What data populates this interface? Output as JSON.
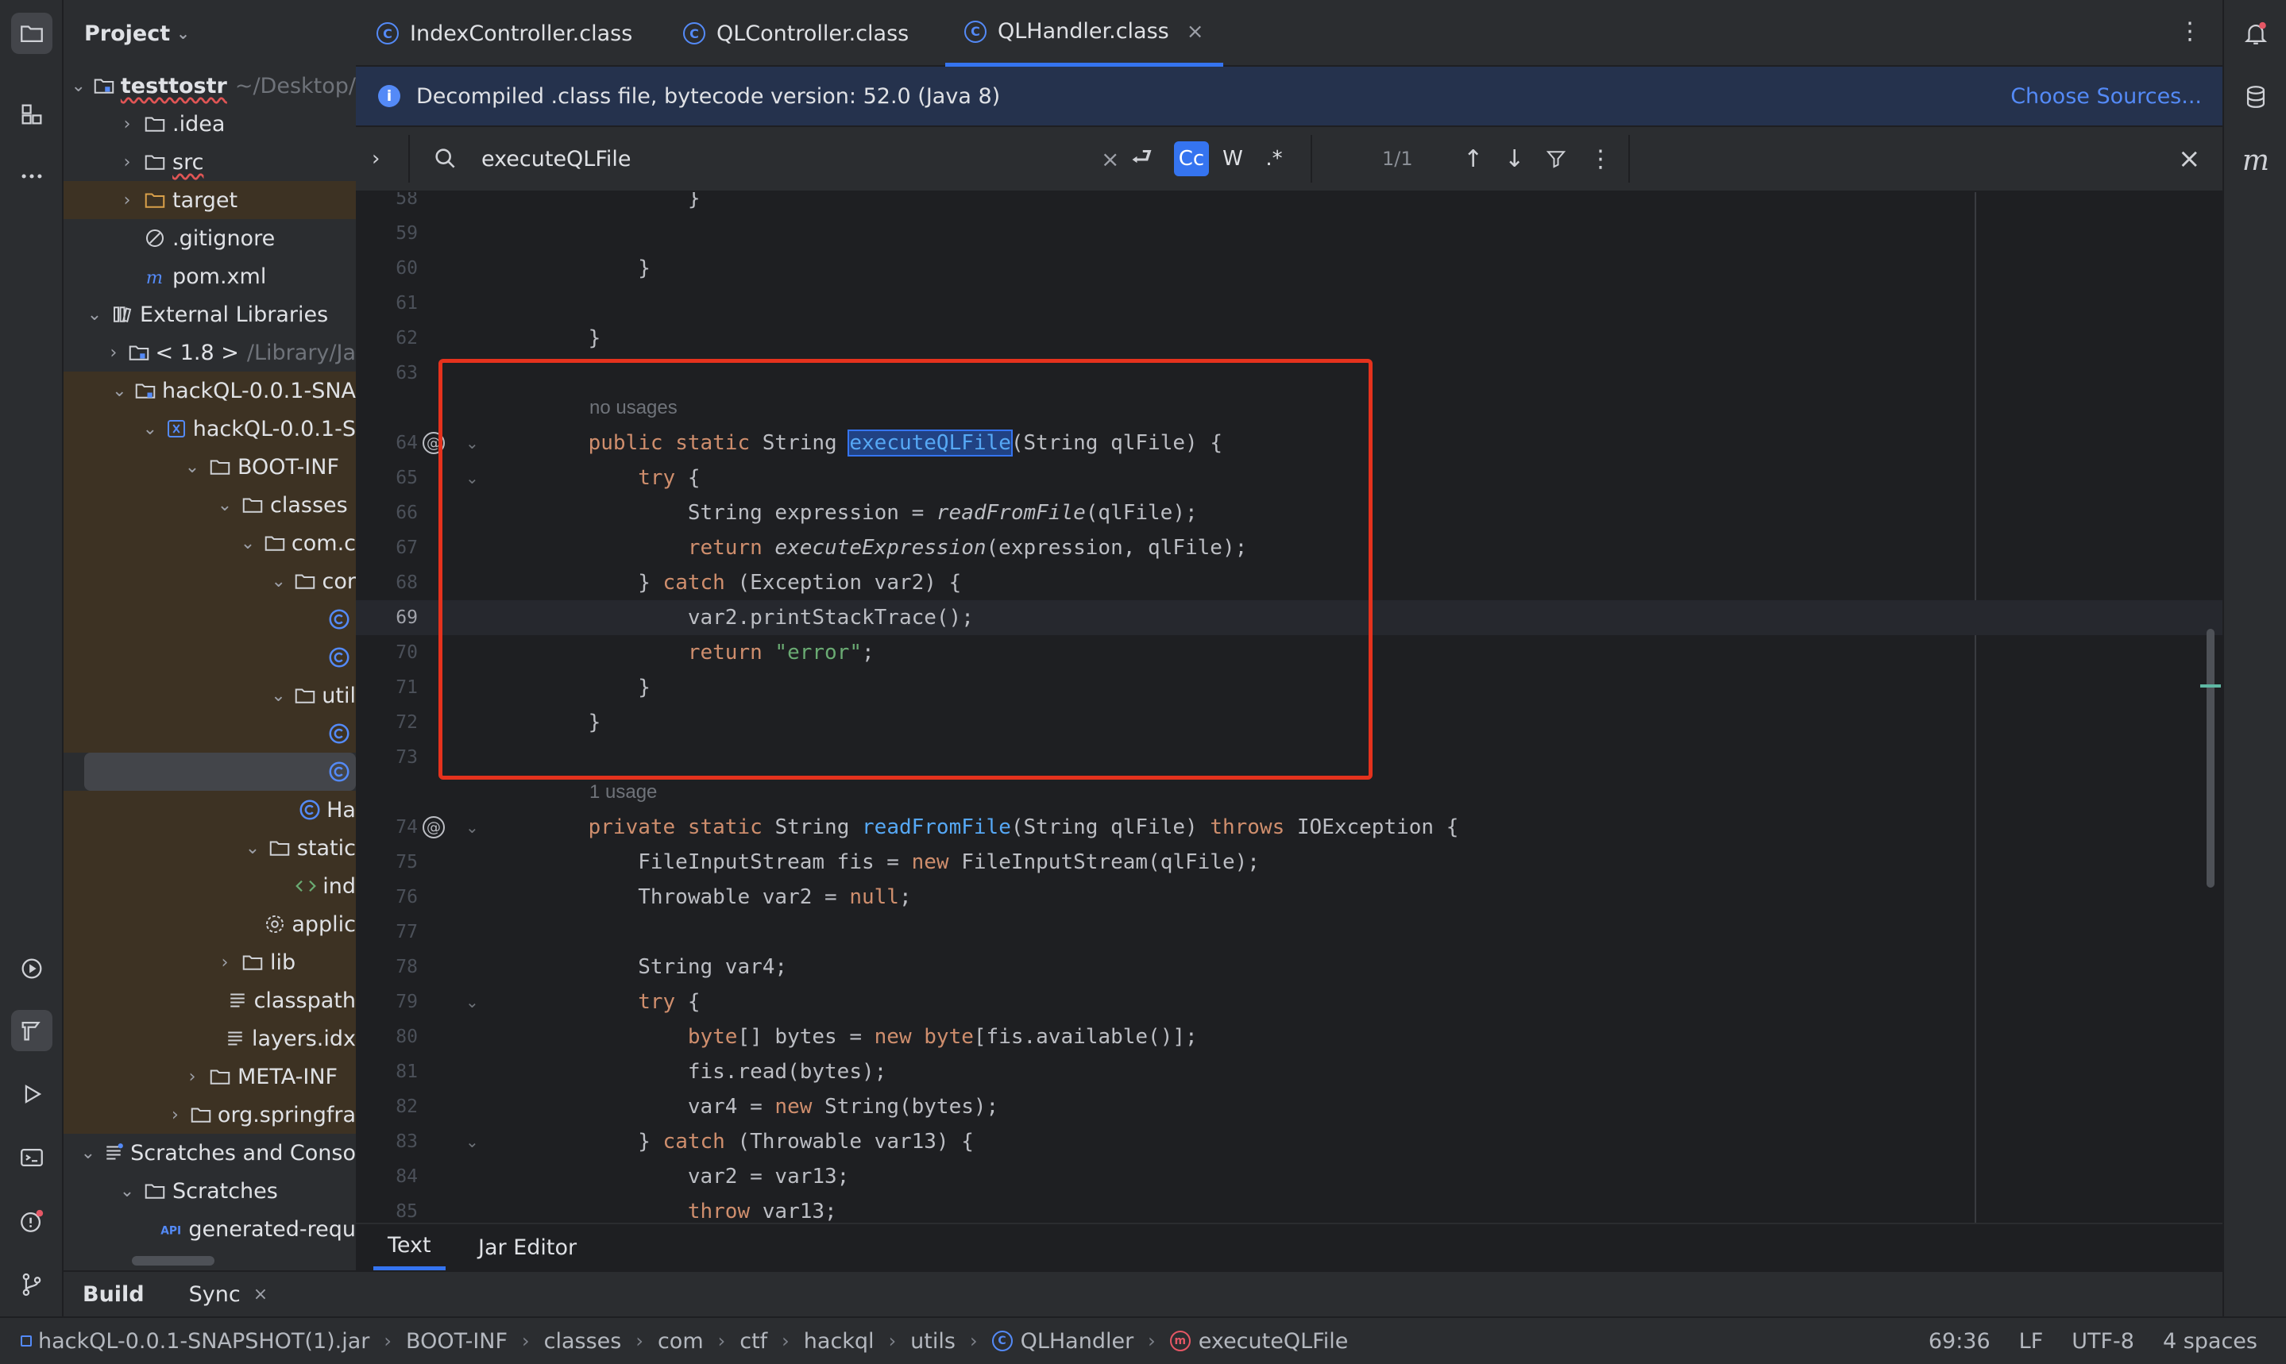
{
  "colors": {
    "accent": "#3574f0",
    "class_icon": "#548af7",
    "keyword": "#cf8e6d",
    "function": "#56a8f5",
    "string": "#6aab73",
    "highlight_box": "#e5321d"
  },
  "project_panel": {
    "title": "Project",
    "tree": [
      {
        "label": "testtostr",
        "hint": "~/Desktop/",
        "icon": "folder-module-icon"
      },
      {
        "label": ".idea",
        "icon": "folder-icon"
      },
      {
        "label": "src",
        "icon": "folder-icon"
      },
      {
        "label": "target",
        "icon": "folder-excluded-icon"
      },
      {
        "label": ".gitignore",
        "icon": "ignore-file-icon"
      },
      {
        "label": "pom.xml",
        "icon": "maven-icon"
      },
      {
        "label": "External Libraries",
        "icon": "library-icon"
      },
      {
        "label": "< 1.8 >",
        "hint": "/Library/Ja",
        "icon": "sdk-folder-icon"
      },
      {
        "label": "hackQL-0.0.1-SNA",
        "icon": "jar-folder-icon"
      },
      {
        "label": "hackQL-0.0.1-S",
        "icon": "archive-icon"
      },
      {
        "label": "BOOT-INF",
        "icon": "folder-icon"
      },
      {
        "label": "classes",
        "icon": "folder-icon"
      },
      {
        "label": "com.c",
        "icon": "folder-icon"
      },
      {
        "label": "cor",
        "icon": "folder-icon"
      },
      {
        "label": "",
        "icon": "class-icon"
      },
      {
        "label": "",
        "icon": "class-icon"
      },
      {
        "label": "util",
        "icon": "folder-icon"
      },
      {
        "label": "",
        "icon": "class-icon"
      },
      {
        "label": "",
        "icon": "class-icon"
      },
      {
        "label": "Ha",
        "icon": "class-icon"
      },
      {
        "label": "static",
        "icon": "folder-icon"
      },
      {
        "label": "ind",
        "icon": "html-icon"
      },
      {
        "label": "applic",
        "icon": "settings-file-icon"
      },
      {
        "label": "lib",
        "icon": "folder-icon"
      },
      {
        "label": "classpath",
        "icon": "text-file-icon"
      },
      {
        "label": "layers.idx",
        "icon": "text-file-icon"
      },
      {
        "label": "META-INF",
        "icon": "folder-icon"
      },
      {
        "label": "org.springfra",
        "icon": "folder-icon"
      },
      {
        "label": "Scratches and Conso",
        "icon": "scratches-icon"
      },
      {
        "label": "Scratches",
        "icon": "folder-icon"
      },
      {
        "label": "generated-requ",
        "icon": "http-request-icon"
      }
    ]
  },
  "editor_tabs": [
    {
      "label": "IndexController.class"
    },
    {
      "label": "QLController.class"
    },
    {
      "label": "QLHandler.class",
      "close": "×"
    }
  ],
  "banner": {
    "message": "Decompiled .class file, bytecode version: 52.0 (Java 8)",
    "link": "Choose Sources..."
  },
  "find_bar": {
    "query": "executeQLFile",
    "clear": "×",
    "match_case": "Cc",
    "words": "W",
    "regex": ".*",
    "count": "1/1"
  },
  "code_lines": [
    {
      "n": "58",
      "segs": [
        {
          "t": "            }"
        }
      ]
    },
    {
      "n": "59",
      "segs": []
    },
    {
      "n": "60",
      "segs": [
        {
          "t": "        }"
        }
      ]
    },
    {
      "n": "61",
      "segs": []
    },
    {
      "n": "62",
      "segs": [
        {
          "t": "    }"
        }
      ]
    },
    {
      "n": "63",
      "segs": []
    },
    {
      "hint": "no usages"
    },
    {
      "n": "64",
      "at": true,
      "fold": true,
      "segs": [
        {
          "t": "    "
        },
        {
          "t": "public static ",
          "c": "kw"
        },
        {
          "t": "String "
        },
        {
          "t": "executeQLFile",
          "c": "fn hl"
        },
        {
          "t": "(String qlFile) {"
        }
      ]
    },
    {
      "n": "65",
      "fold": true,
      "segs": [
        {
          "t": "        "
        },
        {
          "t": "try",
          "c": "kw"
        },
        {
          "t": " {"
        }
      ]
    },
    {
      "n": "66",
      "segs": [
        {
          "t": "            String expression = "
        },
        {
          "t": "readFromFile",
          "c": "it"
        },
        {
          "t": "(qlFile);"
        }
      ]
    },
    {
      "n": "67",
      "segs": [
        {
          "t": "            "
        },
        {
          "t": "return ",
          "c": "kw"
        },
        {
          "t": "executeExpression",
          "c": "it"
        },
        {
          "t": "(expression, qlFile);"
        }
      ]
    },
    {
      "n": "68",
      "segs": [
        {
          "t": "        } "
        },
        {
          "t": "catch",
          "c": "kw"
        },
        {
          "t": " (Exception var2) {"
        }
      ]
    },
    {
      "n": "69",
      "caret": true,
      "segs": [
        {
          "t": "            var2.printStackTrace();"
        }
      ]
    },
    {
      "n": "70",
      "segs": [
        {
          "t": "            "
        },
        {
          "t": "return ",
          "c": "kw"
        },
        {
          "t": "\"error\"",
          "c": "str"
        },
        {
          "t": ";"
        }
      ]
    },
    {
      "n": "71",
      "segs": [
        {
          "t": "        }"
        }
      ]
    },
    {
      "n": "72",
      "segs": [
        {
          "t": "    }"
        }
      ]
    },
    {
      "n": "73",
      "segs": []
    },
    {
      "hint": "1 usage"
    },
    {
      "n": "74",
      "at": true,
      "fold": true,
      "segs": [
        {
          "t": "    "
        },
        {
          "t": "private static ",
          "c": "kw"
        },
        {
          "t": "String "
        },
        {
          "t": "readFromFile",
          "c": "fn"
        },
        {
          "t": "(String qlFile) "
        },
        {
          "t": "throws ",
          "c": "kw"
        },
        {
          "t": "IOException {"
        }
      ]
    },
    {
      "n": "75",
      "segs": [
        {
          "t": "        FileInputStream fis = "
        },
        {
          "t": "new ",
          "c": "kw"
        },
        {
          "t": "FileInputStream(qlFile);"
        }
      ]
    },
    {
      "n": "76",
      "segs": [
        {
          "t": "        Throwable var2 = "
        },
        {
          "t": "null",
          "c": "kw"
        },
        {
          "t": ";"
        }
      ]
    },
    {
      "n": "77",
      "segs": []
    },
    {
      "n": "78",
      "segs": [
        {
          "t": "        String var4;"
        }
      ]
    },
    {
      "n": "79",
      "fold": true,
      "segs": [
        {
          "t": "        "
        },
        {
          "t": "try",
          "c": "kw"
        },
        {
          "t": " {"
        }
      ]
    },
    {
      "n": "80",
      "segs": [
        {
          "t": "            "
        },
        {
          "t": "byte",
          "c": "kw"
        },
        {
          "t": "[] bytes = "
        },
        {
          "t": "new byte",
          "c": "kw"
        },
        {
          "t": "[fis.available()];"
        }
      ]
    },
    {
      "n": "81",
      "segs": [
        {
          "t": "            fis.read(bytes);"
        }
      ]
    },
    {
      "n": "82",
      "segs": [
        {
          "t": "            var4 = "
        },
        {
          "t": "new ",
          "c": "kw"
        },
        {
          "t": "String(bytes);"
        }
      ]
    },
    {
      "n": "83",
      "fold": true,
      "segs": [
        {
          "t": "        } "
        },
        {
          "t": "catch",
          "c": "kw"
        },
        {
          "t": " (Throwable var13) {"
        }
      ]
    },
    {
      "n": "84",
      "segs": [
        {
          "t": "            var2 = var13;"
        }
      ]
    },
    {
      "n": "85",
      "segs": [
        {
          "t": "            "
        },
        {
          "t": "throw ",
          "c": "kw"
        },
        {
          "t": "var13;"
        }
      ]
    }
  ],
  "editor_bottom_tabs": [
    "Text",
    "Jar Editor"
  ],
  "bottom_tool_tabs": {
    "build": "Build",
    "sync": "Sync",
    "close": "×"
  },
  "breadcrumbs": [
    "hackQL-0.0.1-SNAPSHOT(1).jar",
    "BOOT-INF",
    "classes",
    "com",
    "ctf",
    "hackql",
    "utils",
    "QLHandler",
    "executeQLFile"
  ],
  "status": {
    "position": "69:36",
    "line_sep": "LF",
    "encoding": "UTF-8",
    "indent": "4 spaces"
  }
}
